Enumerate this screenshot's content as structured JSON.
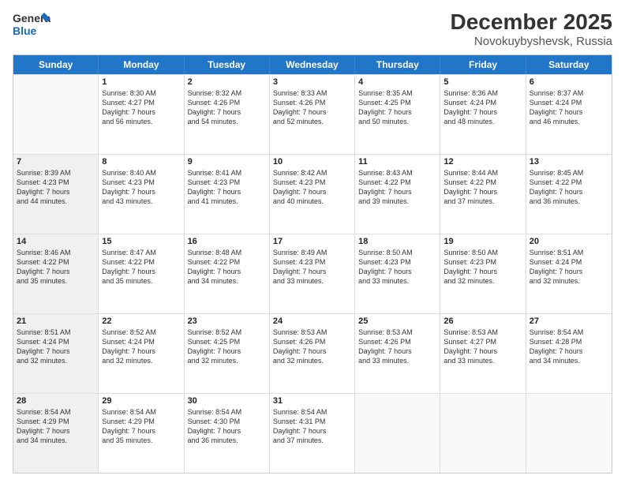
{
  "header": {
    "logo_line1": "General",
    "logo_line2": "Blue",
    "month": "December 2025",
    "location": "Novokuybyshevsk, Russia"
  },
  "weekdays": [
    "Sunday",
    "Monday",
    "Tuesday",
    "Wednesday",
    "Thursday",
    "Friday",
    "Saturday"
  ],
  "rows": [
    [
      {
        "day": "",
        "text": "",
        "empty": true
      },
      {
        "day": "1",
        "text": "Sunrise: 8:30 AM\nSunset: 4:27 PM\nDaylight: 7 hours\nand 56 minutes."
      },
      {
        "day": "2",
        "text": "Sunrise: 8:32 AM\nSunset: 4:26 PM\nDaylight: 7 hours\nand 54 minutes."
      },
      {
        "day": "3",
        "text": "Sunrise: 8:33 AM\nSunset: 4:26 PM\nDaylight: 7 hours\nand 52 minutes."
      },
      {
        "day": "4",
        "text": "Sunrise: 8:35 AM\nSunset: 4:25 PM\nDaylight: 7 hours\nand 50 minutes."
      },
      {
        "day": "5",
        "text": "Sunrise: 8:36 AM\nSunset: 4:24 PM\nDaylight: 7 hours\nand 48 minutes."
      },
      {
        "day": "6",
        "text": "Sunrise: 8:37 AM\nSunset: 4:24 PM\nDaylight: 7 hours\nand 46 minutes."
      }
    ],
    [
      {
        "day": "7",
        "text": "Sunrise: 8:39 AM\nSunset: 4:23 PM\nDaylight: 7 hours\nand 44 minutes.",
        "shaded": true
      },
      {
        "day": "8",
        "text": "Sunrise: 8:40 AM\nSunset: 4:23 PM\nDaylight: 7 hours\nand 43 minutes."
      },
      {
        "day": "9",
        "text": "Sunrise: 8:41 AM\nSunset: 4:23 PM\nDaylight: 7 hours\nand 41 minutes."
      },
      {
        "day": "10",
        "text": "Sunrise: 8:42 AM\nSunset: 4:23 PM\nDaylight: 7 hours\nand 40 minutes."
      },
      {
        "day": "11",
        "text": "Sunrise: 8:43 AM\nSunset: 4:22 PM\nDaylight: 7 hours\nand 39 minutes."
      },
      {
        "day": "12",
        "text": "Sunrise: 8:44 AM\nSunset: 4:22 PM\nDaylight: 7 hours\nand 37 minutes."
      },
      {
        "day": "13",
        "text": "Sunrise: 8:45 AM\nSunset: 4:22 PM\nDaylight: 7 hours\nand 36 minutes."
      }
    ],
    [
      {
        "day": "14",
        "text": "Sunrise: 8:46 AM\nSunset: 4:22 PM\nDaylight: 7 hours\nand 35 minutes.",
        "shaded": true
      },
      {
        "day": "15",
        "text": "Sunrise: 8:47 AM\nSunset: 4:22 PM\nDaylight: 7 hours\nand 35 minutes."
      },
      {
        "day": "16",
        "text": "Sunrise: 8:48 AM\nSunset: 4:22 PM\nDaylight: 7 hours\nand 34 minutes."
      },
      {
        "day": "17",
        "text": "Sunrise: 8:49 AM\nSunset: 4:23 PM\nDaylight: 7 hours\nand 33 minutes."
      },
      {
        "day": "18",
        "text": "Sunrise: 8:50 AM\nSunset: 4:23 PM\nDaylight: 7 hours\nand 33 minutes."
      },
      {
        "day": "19",
        "text": "Sunrise: 8:50 AM\nSunset: 4:23 PM\nDaylight: 7 hours\nand 32 minutes."
      },
      {
        "day": "20",
        "text": "Sunrise: 8:51 AM\nSunset: 4:24 PM\nDaylight: 7 hours\nand 32 minutes."
      }
    ],
    [
      {
        "day": "21",
        "text": "Sunrise: 8:51 AM\nSunset: 4:24 PM\nDaylight: 7 hours\nand 32 minutes.",
        "shaded": true
      },
      {
        "day": "22",
        "text": "Sunrise: 8:52 AM\nSunset: 4:24 PM\nDaylight: 7 hours\nand 32 minutes."
      },
      {
        "day": "23",
        "text": "Sunrise: 8:52 AM\nSunset: 4:25 PM\nDaylight: 7 hours\nand 32 minutes."
      },
      {
        "day": "24",
        "text": "Sunrise: 8:53 AM\nSunset: 4:26 PM\nDaylight: 7 hours\nand 32 minutes."
      },
      {
        "day": "25",
        "text": "Sunrise: 8:53 AM\nSunset: 4:26 PM\nDaylight: 7 hours\nand 33 minutes."
      },
      {
        "day": "26",
        "text": "Sunrise: 8:53 AM\nSunset: 4:27 PM\nDaylight: 7 hours\nand 33 minutes."
      },
      {
        "day": "27",
        "text": "Sunrise: 8:54 AM\nSunset: 4:28 PM\nDaylight: 7 hours\nand 34 minutes."
      }
    ],
    [
      {
        "day": "28",
        "text": "Sunrise: 8:54 AM\nSunset: 4:29 PM\nDaylight: 7 hours\nand 34 minutes.",
        "shaded": true
      },
      {
        "day": "29",
        "text": "Sunrise: 8:54 AM\nSunset: 4:29 PM\nDaylight: 7 hours\nand 35 minutes."
      },
      {
        "day": "30",
        "text": "Sunrise: 8:54 AM\nSunset: 4:30 PM\nDaylight: 7 hours\nand 36 minutes."
      },
      {
        "day": "31",
        "text": "Sunrise: 8:54 AM\nSunset: 4:31 PM\nDaylight: 7 hours\nand 37 minutes."
      },
      {
        "day": "",
        "text": "",
        "empty": true
      },
      {
        "day": "",
        "text": "",
        "empty": true
      },
      {
        "day": "",
        "text": "",
        "empty": true
      }
    ]
  ]
}
